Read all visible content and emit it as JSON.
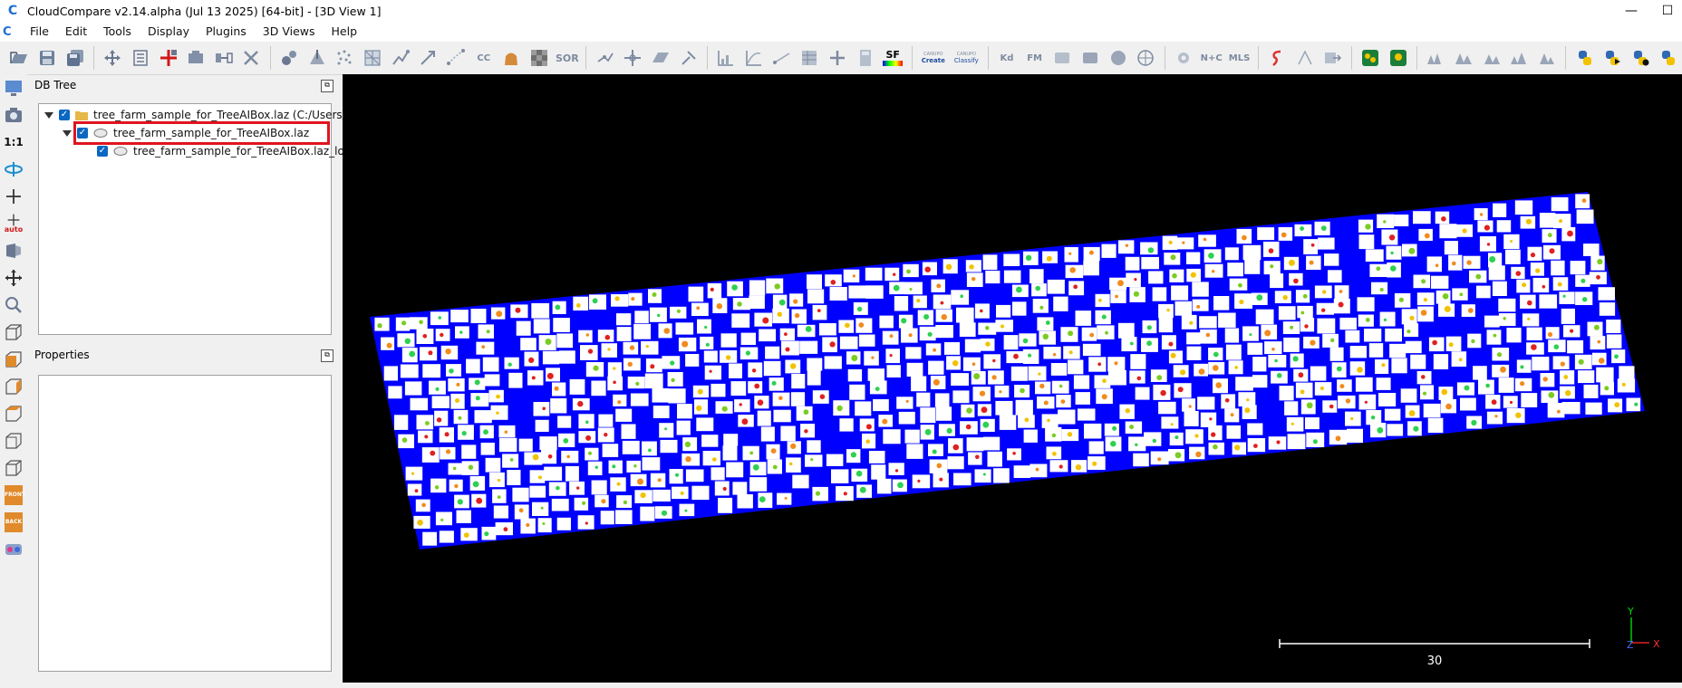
{
  "window": {
    "title": "CloudCompare v2.14.alpha (Jul 13 2025) [64-bit] - [3D View 1]",
    "app_icon_glyph": "C",
    "minimize_glyph": "—",
    "maximize_glyph": "☐"
  },
  "menubar": {
    "items": [
      "File",
      "Edit",
      "Tools",
      "Display",
      "Plugins",
      "3D Views",
      "Help"
    ]
  },
  "toolbar": {
    "sf_label": "SF",
    "sor_label": "SOR",
    "cc_label": "CC",
    "kd_label": "Kd",
    "fm_label": "FM",
    "nc_label": "N+C",
    "mls_label": "MLS",
    "canupo_label": "CANUPO",
    "create_label": "Create",
    "classify_label": "Classify",
    "python_icon": "python-icon"
  },
  "lefttools": {
    "one_to_one": "1:1",
    "auto": "auto",
    "front": "FRONT",
    "back": "BACK"
  },
  "dbtree": {
    "title": "DB Tree",
    "items": [
      {
        "label": "tree_farm_sample_for_TreeAIBox.laz (C:/Users/...",
        "checked": true,
        "level": 0
      },
      {
        "label": "tree_farm_sample_for_TreeAIBox.laz",
        "checked": true,
        "level": 1,
        "highlighted": true
      },
      {
        "label": "tree_farm_sample_for_TreeAIBox.laz_loc",
        "checked": true,
        "level": 2
      }
    ]
  },
  "properties": {
    "title": "Properties"
  },
  "view3d": {
    "scale_label": "30",
    "axis_y": "Y",
    "axis_z": "Z",
    "axis_x": "X",
    "ground_color": "#0000ff",
    "background_color": "#000000"
  },
  "colors": {
    "accent": "#0a68c2",
    "highlight_border": "#e0141e"
  }
}
